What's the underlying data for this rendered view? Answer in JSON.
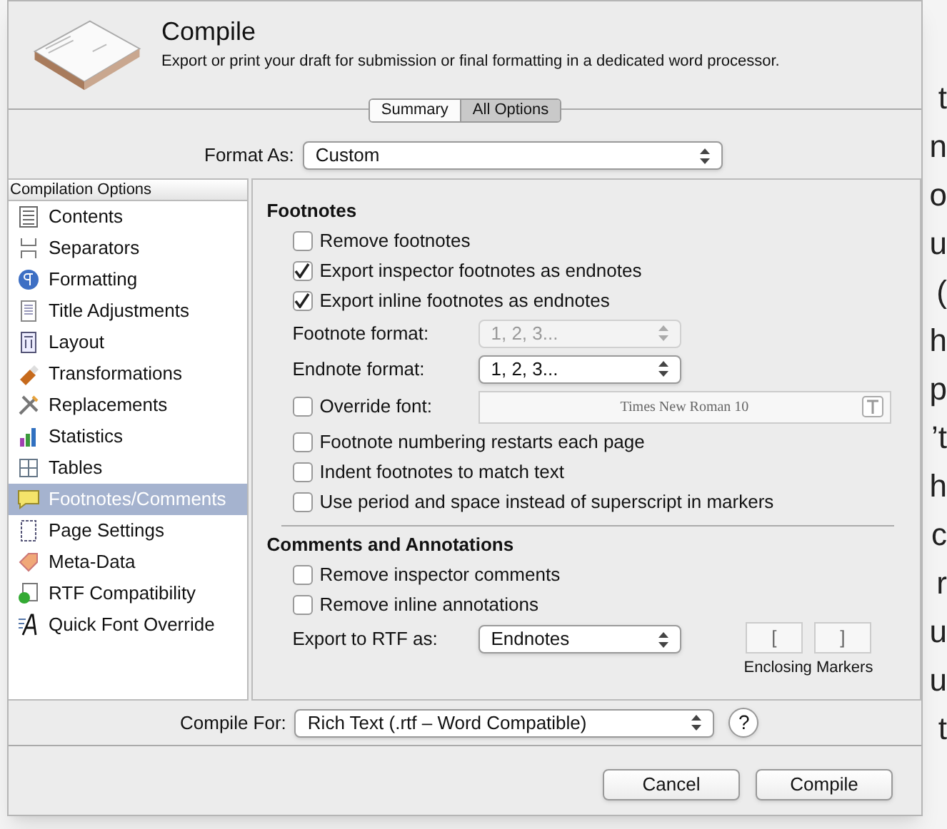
{
  "dialog": {
    "title": "Compile",
    "subtitle": "Export or print your draft for submission or final formatting in a dedicated word processor."
  },
  "tabs": [
    {
      "label": "Summary",
      "selected": false
    },
    {
      "label": "All Options",
      "selected": true
    }
  ],
  "format_as": {
    "label": "Format As:",
    "value": "Custom"
  },
  "sidebar": {
    "header": "Compilation Options",
    "items": [
      {
        "label": "Contents",
        "kind": "list",
        "selected": false
      },
      {
        "label": "Separators",
        "kind": "separator",
        "selected": false
      },
      {
        "label": "Formatting",
        "kind": "pilcrow",
        "selected": false
      },
      {
        "label": "Title Adjustments",
        "kind": "page",
        "selected": false
      },
      {
        "label": "Layout",
        "kind": "layout",
        "selected": false
      },
      {
        "label": "Transformations",
        "kind": "brush",
        "selected": false
      },
      {
        "label": "Replacements",
        "kind": "tools",
        "selected": false
      },
      {
        "label": "Statistics",
        "kind": "bars",
        "selected": false
      },
      {
        "label": "Tables",
        "kind": "table",
        "selected": false
      },
      {
        "label": "Footnotes/Comments",
        "kind": "note",
        "selected": true
      },
      {
        "label": "Page Settings",
        "kind": "pagesetup",
        "selected": false
      },
      {
        "label": "Meta-Data",
        "kind": "tag",
        "selected": false
      },
      {
        "label": "RTF Compatibility",
        "kind": "rtf",
        "selected": false
      },
      {
        "label": "Quick Font Override",
        "kind": "font",
        "selected": false
      }
    ]
  },
  "footnotes": {
    "heading": "Footnotes",
    "options": [
      {
        "kind": "checkbox",
        "label": "Remove footnotes",
        "checked": false
      },
      {
        "kind": "checkbox",
        "label": "Export inspector footnotes as endnotes",
        "checked": true
      },
      {
        "kind": "checkbox",
        "label": "Export inline footnotes as endnotes",
        "checked": true
      },
      {
        "kind": "popup",
        "label": "Footnote format:",
        "value": "1, 2, 3...",
        "disabled": true
      },
      {
        "kind": "popup",
        "label": "Endnote format:",
        "value": "1, 2, 3...",
        "disabled": false
      },
      {
        "kind": "font",
        "label": "Override font:",
        "checked": false,
        "value": "Times New Roman 10"
      },
      {
        "kind": "checkbox",
        "label": "Footnote numbering restarts each page",
        "checked": false
      },
      {
        "kind": "checkbox",
        "label": "Indent footnotes to match text",
        "checked": false
      },
      {
        "kind": "checkbox",
        "label": "Use period and space instead of superscript in markers",
        "checked": false
      }
    ]
  },
  "comments": {
    "heading": "Comments and Annotations",
    "options": [
      {
        "kind": "checkbox",
        "label": "Remove inspector comments",
        "checked": false
      },
      {
        "kind": "checkbox",
        "label": "Remove inline annotations",
        "checked": false
      }
    ],
    "export_label": "Export to RTF as:",
    "export_value": "Endnotes",
    "markers": [
      "[",
      "]"
    ],
    "markers_label": "Enclosing Markers"
  },
  "compile_for": {
    "label": "Compile For:",
    "value": "Rich Text (.rtf – Word Compatible)",
    "help": "?"
  },
  "buttons": [
    "Cancel",
    "Compile"
  ],
  "document_edge": [
    "t",
    "n",
    "o",
    "u",
    "(",
    "h",
    "p",
    "’t",
    "h",
    "c",
    "r",
    "u",
    "u",
    "t"
  ]
}
